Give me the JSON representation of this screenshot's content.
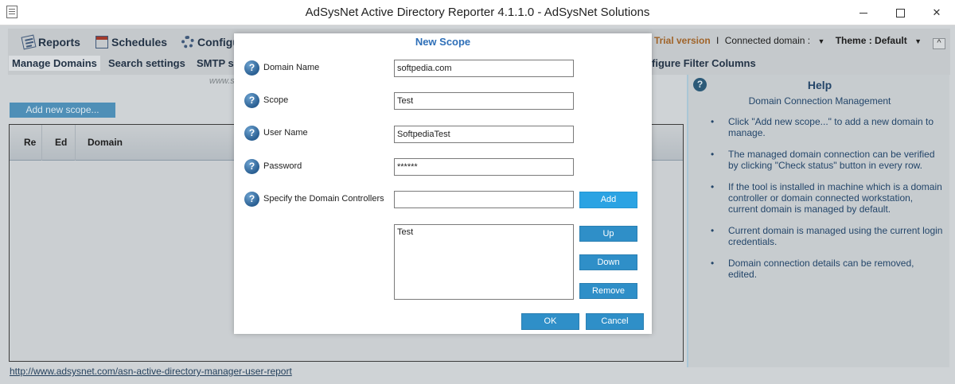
{
  "window": {
    "title": "AdSysNet Active Directory Reporter 4.1.1.0 - AdSysNet Solutions"
  },
  "menu": {
    "tabs": [
      {
        "label": "Reports",
        "icon": "reports-icon"
      },
      {
        "label": "Schedules",
        "icon": "calendar-icon"
      },
      {
        "label": "Configu",
        "icon": "gear-icon"
      }
    ]
  },
  "status": {
    "trial": "Trial version",
    "separator": "I",
    "connected_domain": "Connected domain :",
    "theme": "Theme : Default"
  },
  "subtabs": {
    "manage_domains": "Manage Domains",
    "search_settings": "Search settings",
    "smtp": "SMTP se",
    "configure_filter": "figure Filter Columns"
  },
  "watermark": "www.softpedia.com",
  "main": {
    "add_scope": "Add new scope...",
    "grid_columns": [
      "Re",
      "Ed",
      "Domain"
    ],
    "footer_link": "http://www.adsysnet.com/asn-active-directory-manager-user-report"
  },
  "help": {
    "title": "Help",
    "subtitle": "Domain Connection Management",
    "items": [
      "Click \"Add new scope...\" to add a new domain to manage.",
      "The managed domain connection can be verified by clicking \"Check status\" button in every row.",
      "If the tool is installed in machine which is a domain controller or domain connected workstation, current domain is managed by default.",
      "Current domain is managed using the current login credentials.",
      "Domain connection details can be removed, edited."
    ]
  },
  "dialog": {
    "title": "New Scope",
    "fields": {
      "domain_name": {
        "label": "Domain Name",
        "value": "softpedia.com"
      },
      "scope": {
        "label": "Scope",
        "value": "Test"
      },
      "user_name": {
        "label": "User Name",
        "value": "SoftpediaTest"
      },
      "password": {
        "label": "Password",
        "value": "******"
      },
      "domain_controllers": {
        "label": "Specify the Domain Controllers",
        "value": ""
      }
    },
    "controllers_list": [
      "Test"
    ],
    "buttons": {
      "add": "Add",
      "up": "Up",
      "down": "Down",
      "remove": "Remove",
      "ok": "OK",
      "cancel": "Cancel"
    }
  },
  "colors": {
    "dialog_title": "#2e6fb8",
    "button_blue": "#2f8fc8",
    "trial": "#a0642a"
  }
}
